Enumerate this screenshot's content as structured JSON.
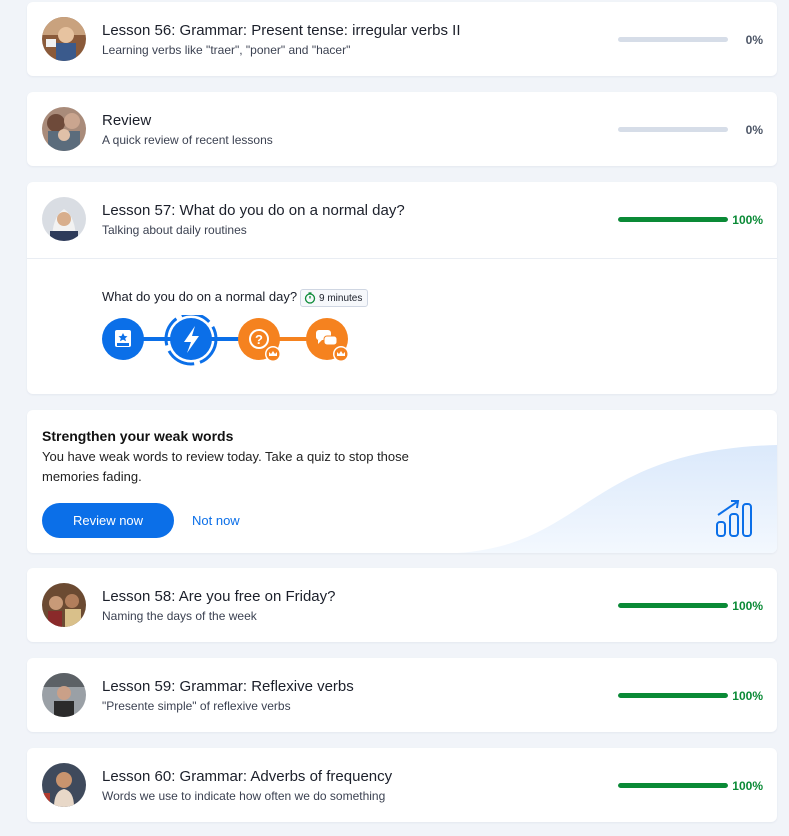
{
  "lessons_top": [
    {
      "title": "Lesson 56: Grammar: Present tense: irregular verbs II",
      "subtitle": "Learning verbs like \"traer\", \"poner\" and \"hacer\"",
      "progress": 0,
      "percent_label": "0%"
    },
    {
      "title": "Review",
      "subtitle": "A quick review of recent lessons",
      "progress": 0,
      "percent_label": "0%"
    },
    {
      "title": "Lesson 57: What do you do on a normal day?",
      "subtitle": "Talking about daily routines",
      "progress": 1,
      "percent_label": "100%"
    }
  ],
  "activity": {
    "title": "What do you do on a normal day?",
    "duration": "9 minutes",
    "steps": [
      {
        "icon": "flashcard-icon",
        "state": "completed",
        "color": "#0b6fe8"
      },
      {
        "icon": "lightning-icon",
        "state": "current",
        "color": "#0b6fe8"
      },
      {
        "icon": "question-icon",
        "state": "locked-premium",
        "color": "#f5821f"
      },
      {
        "icon": "chat-icon",
        "state": "locked-premium",
        "color": "#f5821f"
      }
    ]
  },
  "weak_words": {
    "title": "Strengthen your weak words",
    "text": "You have weak words to review today. Take a quiz to stop those memories fading.",
    "primary_button": "Review now",
    "secondary_button": "Not now",
    "icon": "bar-chart-trending-icon"
  },
  "lessons_bottom": [
    {
      "title": "Lesson 58: Are you free on Friday?",
      "subtitle": "Naming the days of the week",
      "progress": 1,
      "percent_label": "100%"
    },
    {
      "title": "Lesson 59: Grammar: Reflexive verbs",
      "subtitle": "\"Presente simple\" of reflexive verbs",
      "progress": 1,
      "percent_label": "100%"
    },
    {
      "title": "Lesson 60: Grammar: Adverbs of frequency",
      "subtitle": "Words we use to indicate how often we do something",
      "progress": 1,
      "percent_label": "100%"
    }
  ],
  "colors": {
    "accent": "#0b6fe8",
    "success": "#0a8a36",
    "premium": "#f5821f"
  }
}
